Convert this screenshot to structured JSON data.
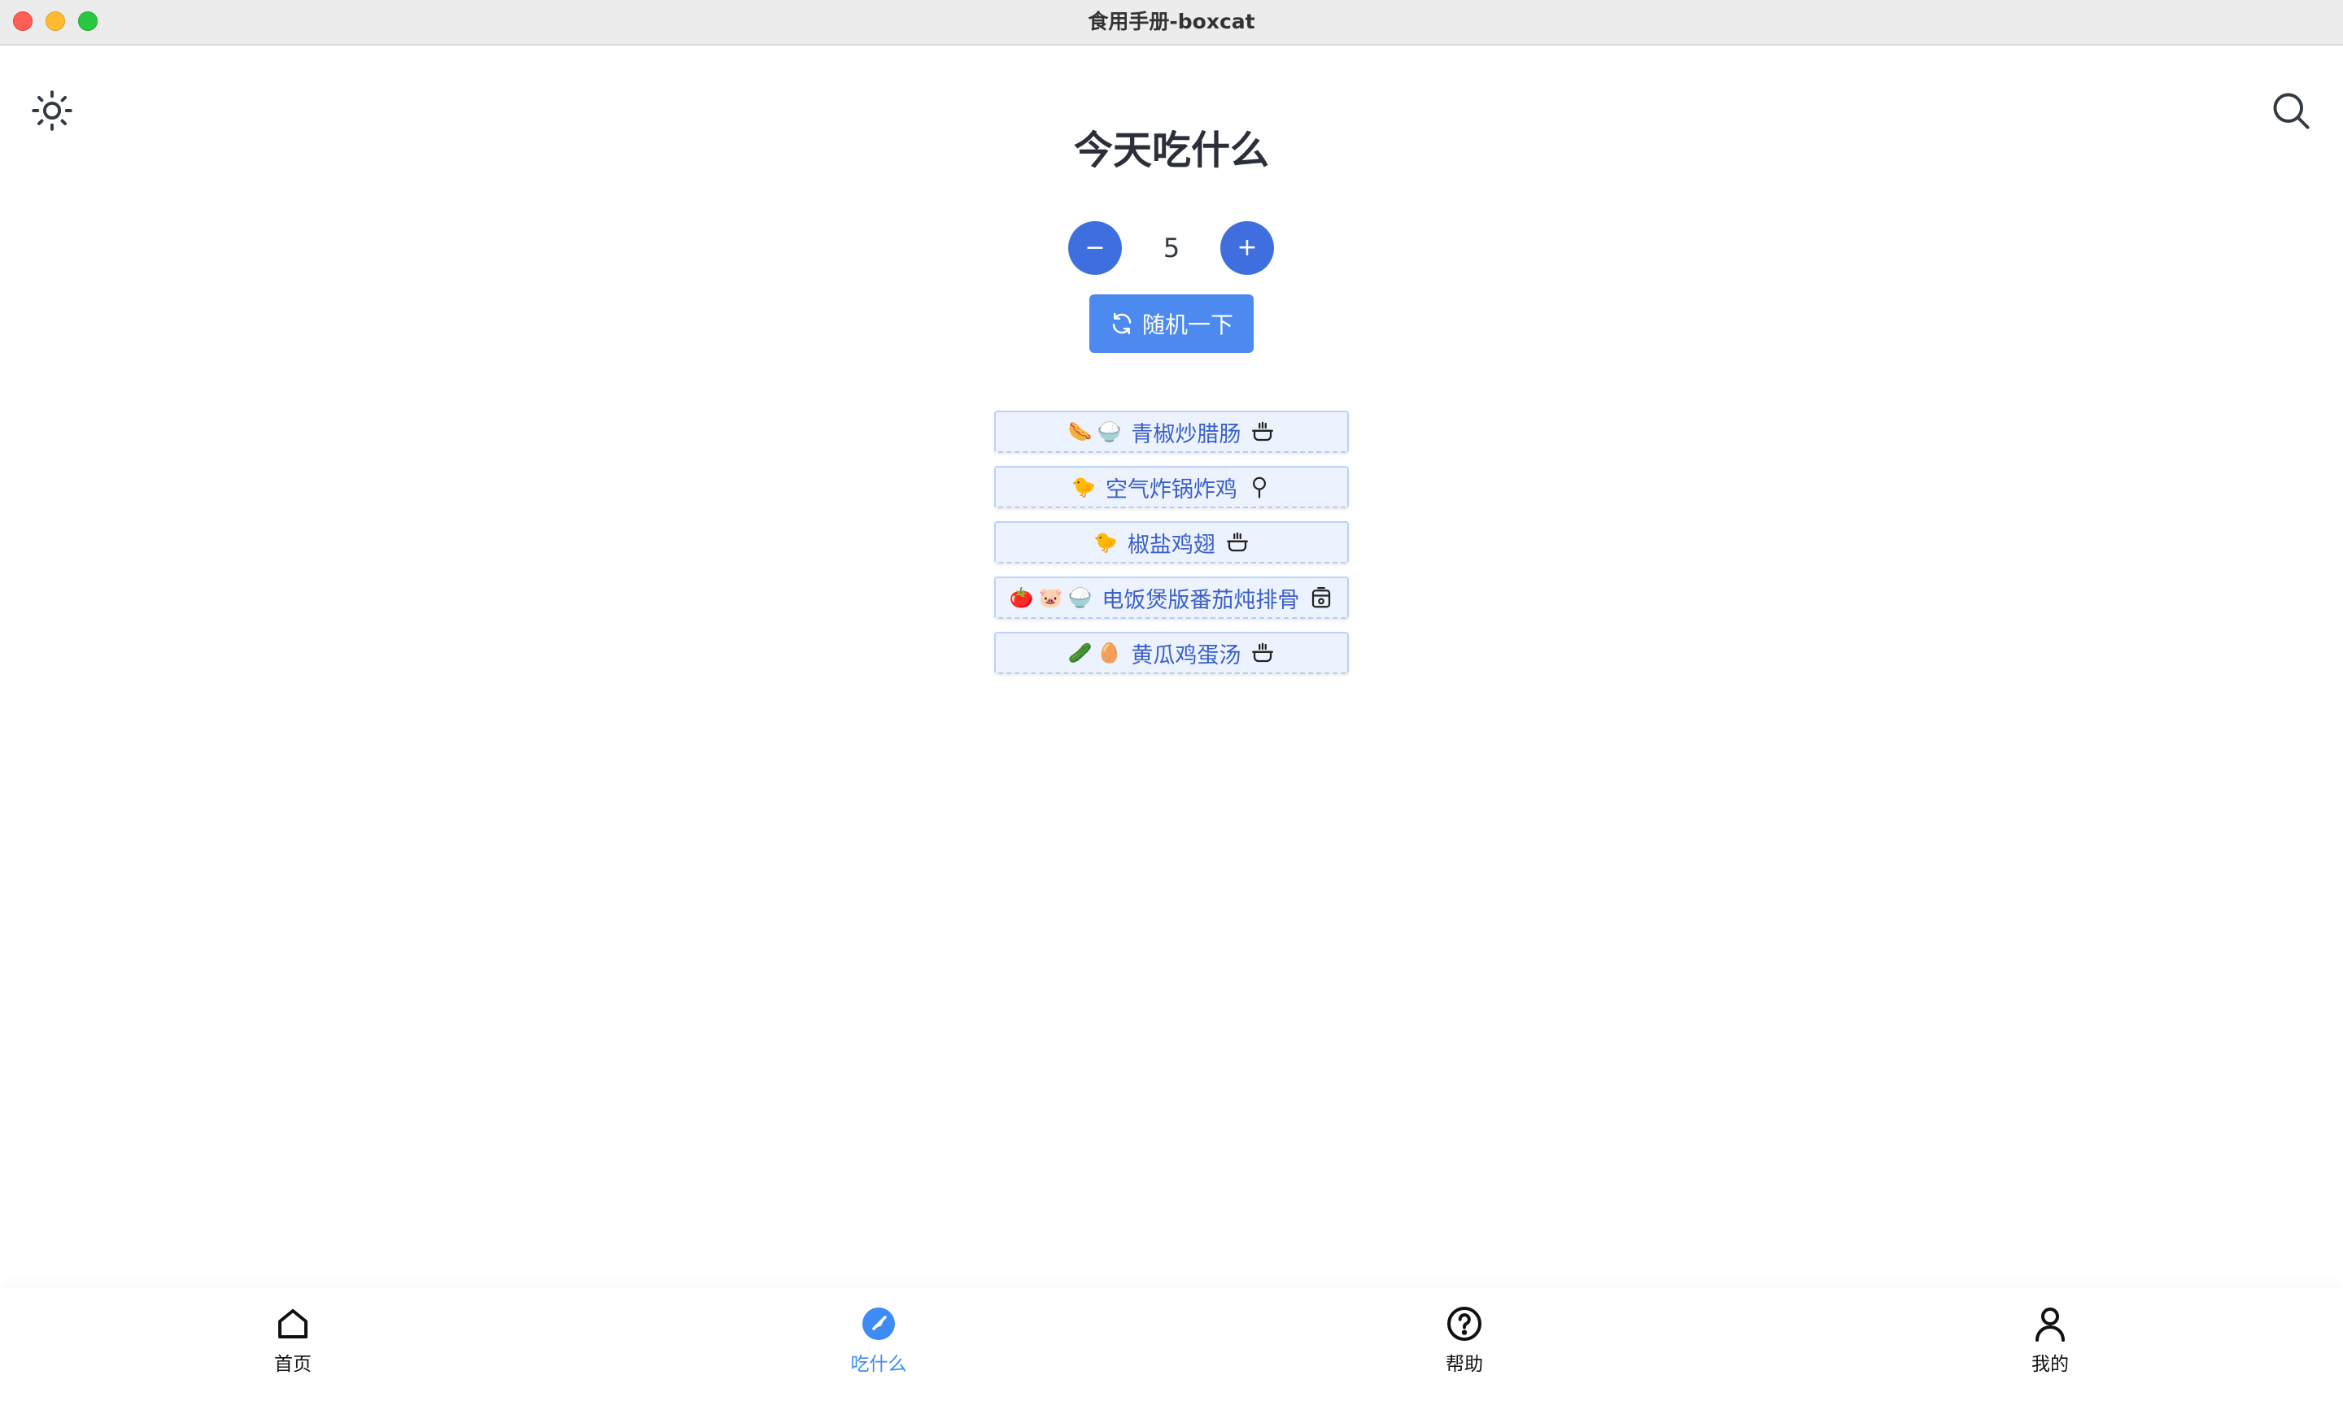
{
  "window": {
    "title": "食用手册-boxcat"
  },
  "header": {
    "theme_icon": "sun-icon",
    "search_icon": "search-icon"
  },
  "page": {
    "title": "今天吃什么"
  },
  "stepper": {
    "minus_label": "−",
    "plus_label": "+",
    "value": "5"
  },
  "random_button": {
    "icon": "refresh-icon",
    "label": "随机一下"
  },
  "dishes": [
    {
      "emojis": [
        "🌭",
        "🍚"
      ],
      "name": "青椒炒腊肠",
      "tool": "wok-icon"
    },
    {
      "emojis": [
        "🐤"
      ],
      "name": "空气炸锅炸鸡",
      "tool": "air-fryer-icon"
    },
    {
      "emojis": [
        "🐤"
      ],
      "name": "椒盐鸡翅",
      "tool": "wok-icon"
    },
    {
      "emojis": [
        "🍅",
        "🐷",
        "🍚"
      ],
      "name": "电饭煲版番茄炖排骨",
      "tool": "rice-cooker-icon"
    },
    {
      "emojis": [
        "🥒",
        "🥚"
      ],
      "name": "黄瓜鸡蛋汤",
      "tool": "wok-icon"
    }
  ],
  "bottom_nav": {
    "items": [
      {
        "label": "首页",
        "icon": "home-icon",
        "active": false
      },
      {
        "label": "吃什么",
        "icon": "compass-icon",
        "active": true
      },
      {
        "label": "帮助",
        "icon": "help-icon",
        "active": false
      },
      {
        "label": "我的",
        "icon": "user-icon",
        "active": false
      }
    ]
  },
  "colors": {
    "accent": "#3f6fdf",
    "random_button": "#4d8af0",
    "nav_active": "#3d8cf5",
    "dish_bg": "#edf3fe",
    "dish_text": "#3a5fc9"
  }
}
